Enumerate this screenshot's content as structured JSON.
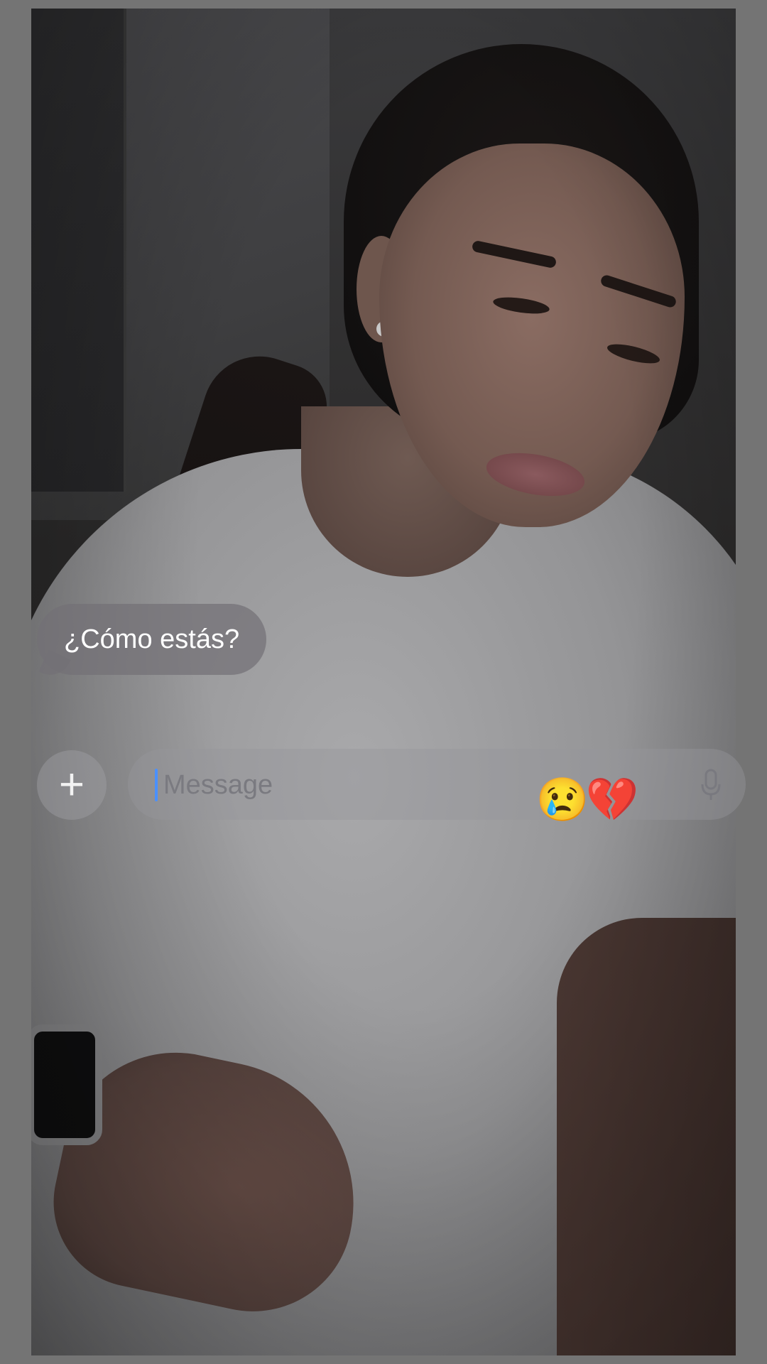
{
  "photo": {
    "description_icon": "selfie-photo"
  },
  "message": {
    "received_text": "¿Cómo estás?"
  },
  "compose": {
    "placeholder": "Message",
    "plus_icon": "plus-icon",
    "mic_icon": "microphone-icon",
    "plus_glyph": "+"
  },
  "emojis": {
    "crying": "😢",
    "broken_heart": "💔"
  }
}
